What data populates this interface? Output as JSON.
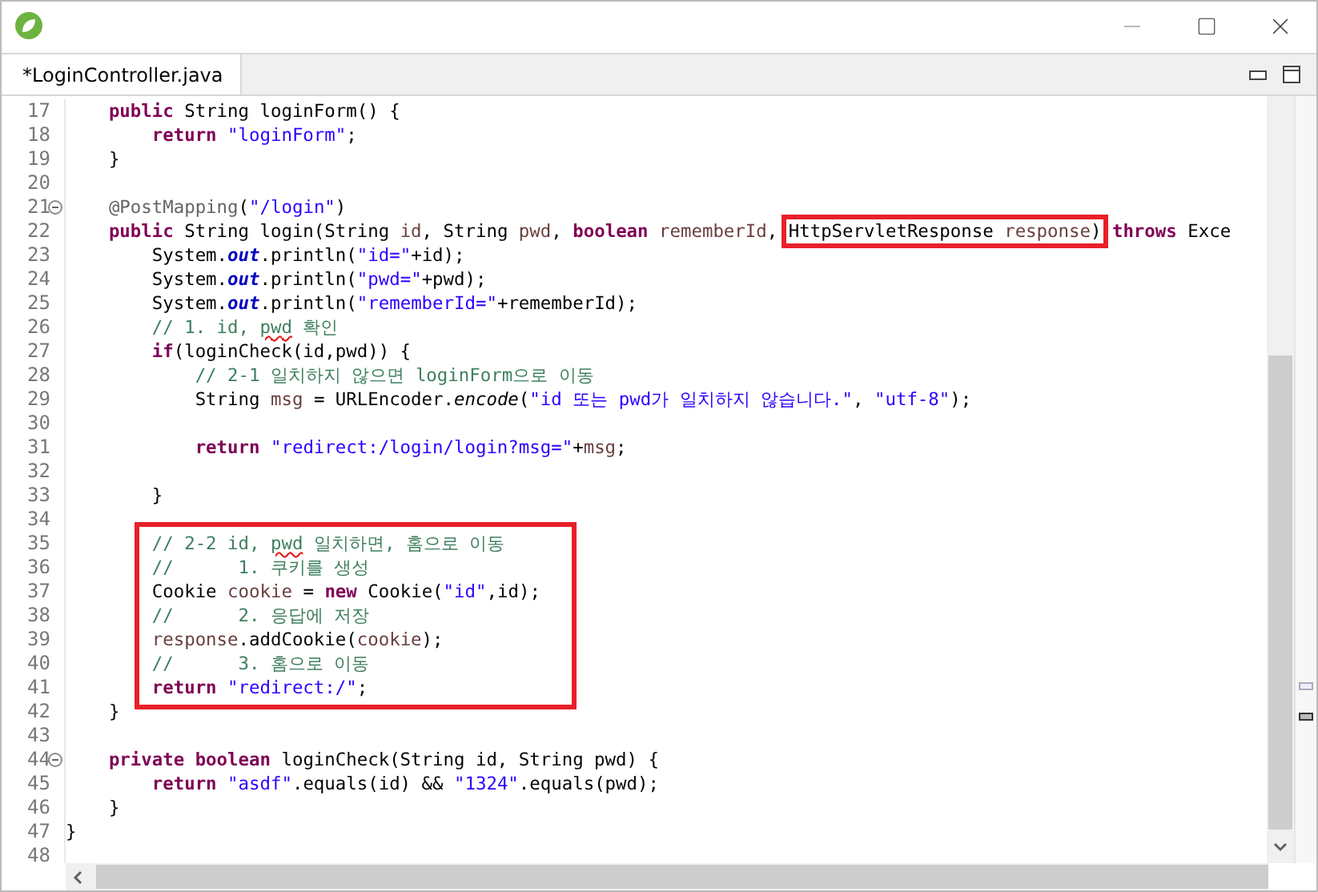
{
  "tab": {
    "label": "*LoginController.java",
    "selected": true
  },
  "editor": {
    "lines": [
      {
        "kind": "line",
        "number": "17",
        "fold": false,
        "tokens": [
          {
            "kind": "keyword",
            "text": "    public"
          },
          {
            "kind": "plain",
            "text": " String loginForm() {"
          }
        ]
      },
      {
        "kind": "line",
        "number": "18",
        "fold": false,
        "tokens": [
          {
            "kind": "keyword",
            "text": "        return"
          },
          {
            "kind": "string",
            "text": " \"loginForm\""
          },
          {
            "kind": "plain",
            "text": ";"
          }
        ]
      },
      {
        "kind": "line",
        "number": "19",
        "fold": false,
        "tokens": [
          {
            "kind": "plain",
            "text": "    }"
          }
        ]
      },
      {
        "kind": "line",
        "number": "20",
        "fold": false
      },
      {
        "kind": "line",
        "number": "21",
        "fold": true,
        "tokens": [
          {
            "kind": "annotation",
            "text": "    @PostMapping"
          },
          {
            "kind": "plain",
            "text": "("
          },
          {
            "kind": "string",
            "text": "\"/login\""
          },
          {
            "kind": "plain",
            "text": ")"
          }
        ]
      },
      {
        "kind": "line",
        "number": "22",
        "fold": false,
        "tokens": [
          {
            "kind": "keyword",
            "text": "    public"
          },
          {
            "kind": "plain",
            "text": " String login(String "
          },
          {
            "kind": "variable",
            "text": "id"
          },
          {
            "kind": "plain",
            "text": ", String "
          },
          {
            "kind": "variable",
            "text": "pwd"
          },
          {
            "kind": "plain",
            "text": ", "
          },
          {
            "kind": "keyword",
            "text": "boolean"
          },
          {
            "kind": "variable",
            "text": " rememberId"
          },
          {
            "kind": "plain",
            "text": ", "
          },
          {
            "kind": "boxed",
            "tokens": [
              {
                "kind": "plain",
                "text": "HttpServletResponse "
              },
              {
                "kind": "variable",
                "text": "response"
              },
              {
                "kind": "plain",
                "text": ")"
              }
            ]
          },
          {
            "kind": "keyword",
            "text": " throws"
          },
          {
            "kind": "plain",
            "text": " Exce"
          }
        ]
      },
      {
        "kind": "line",
        "number": "23",
        "fold": false,
        "tokens": [
          {
            "kind": "plain",
            "text": "        System."
          },
          {
            "kind": "field",
            "text": "out"
          },
          {
            "kind": "plain",
            "text": ".println("
          },
          {
            "kind": "string",
            "text": "\"id=\""
          },
          {
            "kind": "plain",
            "text": "+id);"
          }
        ]
      },
      {
        "kind": "line",
        "number": "24",
        "fold": false,
        "tokens": [
          {
            "kind": "plain",
            "text": "        System."
          },
          {
            "kind": "field",
            "text": "out"
          },
          {
            "kind": "plain",
            "text": ".println("
          },
          {
            "kind": "string",
            "text": "\"pwd=\""
          },
          {
            "kind": "plain",
            "text": "+pwd);"
          }
        ]
      },
      {
        "kind": "line",
        "number": "25",
        "fold": false,
        "tokens": [
          {
            "kind": "plain",
            "text": "        System."
          },
          {
            "kind": "field",
            "text": "out"
          },
          {
            "kind": "plain",
            "text": ".println("
          },
          {
            "kind": "string",
            "text": "\"rememberId=\""
          },
          {
            "kind": "plain",
            "text": "+rememberId);"
          }
        ]
      },
      {
        "kind": "line",
        "number": "26",
        "fold": false,
        "tokens": [
          {
            "kind": "comment",
            "text": "        // 1. id, "
          },
          {
            "kind": "misspelled",
            "text": "pwd"
          },
          {
            "kind": "comment",
            "text": " 확인"
          }
        ]
      },
      {
        "kind": "line",
        "number": "27",
        "fold": false,
        "tokens": [
          {
            "kind": "keyword",
            "text": "        if"
          },
          {
            "kind": "plain",
            "text": "(loginCheck(id,pwd)) {"
          }
        ]
      },
      {
        "kind": "line",
        "number": "28",
        "fold": false,
        "tokens": [
          {
            "kind": "comment",
            "text": "            // 2-1 일치하지 않으면 loginForm으로 이동"
          }
        ]
      },
      {
        "kind": "line",
        "number": "29",
        "fold": false,
        "tokens": [
          {
            "kind": "plain",
            "text": "            String "
          },
          {
            "kind": "variable",
            "text": "msg"
          },
          {
            "kind": "plain",
            "text": " = URLEncoder."
          },
          {
            "kind": "method",
            "text": "encode"
          },
          {
            "kind": "plain",
            "text": "("
          },
          {
            "kind": "string",
            "text": "\"id 또는 pwd가 일치하지 않습니다.\""
          },
          {
            "kind": "plain",
            "text": ", "
          },
          {
            "kind": "string",
            "text": "\"utf-8\""
          },
          {
            "kind": "plain",
            "text": ");"
          }
        ]
      },
      {
        "kind": "line",
        "number": "30",
        "fold": false
      },
      {
        "kind": "line",
        "number": "31",
        "fold": false,
        "tokens": [
          {
            "kind": "keyword",
            "text": "            return"
          },
          {
            "kind": "string",
            "text": " \"redirect:/login/login?msg=\""
          },
          {
            "kind": "plain",
            "text": "+"
          },
          {
            "kind": "variable",
            "text": "msg"
          },
          {
            "kind": "plain",
            "text": ";"
          }
        ]
      },
      {
        "kind": "line",
        "number": "32",
        "fold": false
      },
      {
        "kind": "line",
        "number": "33",
        "fold": false,
        "tokens": [
          {
            "kind": "plain",
            "text": "        }"
          }
        ]
      },
      {
        "kind": "line",
        "number": "34",
        "fold": false
      },
      {
        "kind": "boxed_block",
        "lines": [
          {
            "kind": "line",
            "number": "35",
            "fold": false,
            "tokens": [
              {
                "kind": "comment",
                "text": "        // 2-2 id, "
              },
              {
                "kind": "misspelled",
                "text": "pwd"
              },
              {
                "kind": "comment",
                "text": " 일치하면, 홈으로 이동"
              }
            ]
          },
          {
            "kind": "line",
            "number": "36",
            "fold": false,
            "tokens": [
              {
                "kind": "comment",
                "text": "        //      1. 쿠키를 생성"
              }
            ]
          },
          {
            "kind": "line",
            "number": "37",
            "fold": false,
            "tokens": [
              {
                "kind": "plain",
                "text": "        Cookie "
              },
              {
                "kind": "variable",
                "text": "cookie"
              },
              {
                "kind": "plain",
                "text": " = "
              },
              {
                "kind": "keyword",
                "text": "new"
              },
              {
                "kind": "plain",
                "text": " Cookie("
              },
              {
                "kind": "string",
                "text": "\"id\""
              },
              {
                "kind": "plain",
                "text": ",id);"
              }
            ]
          },
          {
            "kind": "line",
            "number": "38",
            "fold": false,
            "tokens": [
              {
                "kind": "comment",
                "text": "        //      2. 응답에 저장"
              }
            ]
          },
          {
            "kind": "line",
            "number": "39",
            "fold": false,
            "tokens": [
              {
                "kind": "variable",
                "text": "        response"
              },
              {
                "kind": "plain",
                "text": ".addCookie("
              },
              {
                "kind": "variable",
                "text": "cookie"
              },
              {
                "kind": "plain",
                "text": ");"
              }
            ]
          },
          {
            "kind": "line",
            "number": "40",
            "fold": false,
            "tokens": [
              {
                "kind": "comment",
                "text": "        //      3. 홈으로 이동"
              }
            ]
          },
          {
            "kind": "line",
            "number": "41",
            "fold": false,
            "tokens": [
              {
                "kind": "keyword",
                "text": "        return"
              },
              {
                "kind": "string",
                "text": " \"redirect:/\""
              },
              {
                "kind": "plain",
                "text": ";"
              }
            ]
          }
        ]
      },
      {
        "kind": "line",
        "number": "42",
        "fold": false,
        "tokens": [
          {
            "kind": "plain",
            "text": "    }"
          }
        ]
      },
      {
        "kind": "line",
        "number": "43",
        "fold": false
      },
      {
        "kind": "line",
        "number": "44",
        "fold": true,
        "tokens": [
          {
            "kind": "keyword",
            "text": "    private boolean"
          },
          {
            "kind": "plain",
            "text": " loginCheck(String id, String pwd) {"
          }
        ]
      },
      {
        "kind": "line",
        "number": "45",
        "fold": false,
        "tokens": [
          {
            "kind": "keyword",
            "text": "        return"
          },
          {
            "kind": "string",
            "text": " \"asdf\""
          },
          {
            "kind": "plain",
            "text": ".equals(id) && "
          },
          {
            "kind": "string",
            "text": "\"1324\""
          },
          {
            "kind": "plain",
            "text": ".equals(pwd);"
          }
        ]
      },
      {
        "kind": "line",
        "number": "46",
        "fold": false,
        "tokens": [
          {
            "kind": "plain",
            "text": "    }"
          }
        ]
      },
      {
        "kind": "line",
        "number": "47",
        "fold": false,
        "tokens": [
          {
            "kind": "plain",
            "text": "}"
          }
        ]
      },
      {
        "kind": "line",
        "number": "48",
        "fold": false
      }
    ]
  }
}
